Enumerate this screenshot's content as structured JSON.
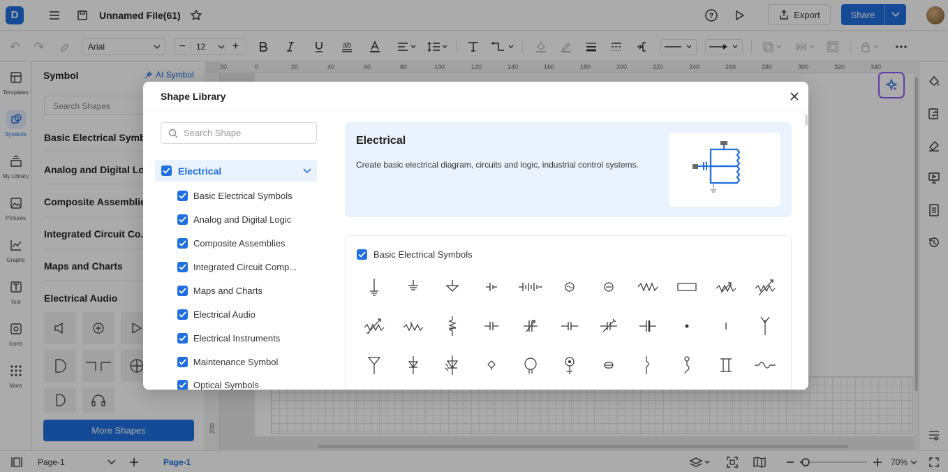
{
  "app": {
    "file_title": "Unnamed File(61)",
    "export_label": "Export",
    "share_label": "Share",
    "logo_glyph": "D"
  },
  "toolbar": {
    "font_name": "Arial",
    "font_size": "12",
    "minus": "−",
    "plus": "+"
  },
  "rail": {
    "items": [
      {
        "label": "Templates",
        "icon": "templates-icon"
      },
      {
        "label": "Symbols",
        "icon": "symbols-icon"
      },
      {
        "label": "My Library",
        "icon": "library-icon"
      },
      {
        "label": "Pictures",
        "icon": "pictures-icon"
      },
      {
        "label": "Graphs",
        "icon": "graphs-icon"
      },
      {
        "label": "Text",
        "icon": "text-icon"
      },
      {
        "label": "Icons",
        "icon": "icons-icon"
      },
      {
        "label": "More",
        "icon": "more-icon"
      }
    ]
  },
  "symbol_panel": {
    "title": "Symbol",
    "ai_symbol": "AI Symbol",
    "search_placeholder": "Search Shapes",
    "categories": [
      "Basic Electrical Symbols",
      "Analog and Digital Logic",
      "Composite Assemblies",
      "Integrated Circuit Co...",
      "Maps and Charts",
      "Electrical Audio"
    ],
    "more_shapes": "More Shapes"
  },
  "ruler": {
    "top": [
      "20",
      "0",
      "20",
      "40",
      "60",
      "80",
      "100",
      "120",
      "140",
      "160",
      "180",
      "200",
      "220",
      "240",
      "260",
      "280",
      "300",
      "320",
      "340"
    ],
    "left": [
      "200"
    ]
  },
  "bottombar": {
    "page_select": "Page-1",
    "page_tab": "Page-1",
    "zoom": "70%"
  },
  "modal": {
    "title": "Shape Library",
    "search_placeholder": "Search Shape",
    "tree_root": "Electrical",
    "tree_items": [
      "Basic Electrical Symbols",
      "Analog and Digital Logic",
      "Composite Assemblies",
      "Integrated Circuit Comp...",
      "Maps and Charts",
      "Electrical Audio",
      "Electrical Instruments",
      "Maintenance Symbol",
      "Optical Symbols"
    ],
    "hero": {
      "title": "Electrical",
      "description": "Create basic electrical diagram, circuits and logic, industrial control systems."
    },
    "grid_section_title": "Basic Electrical Symbols",
    "accent_color": "#1f6fe0"
  }
}
